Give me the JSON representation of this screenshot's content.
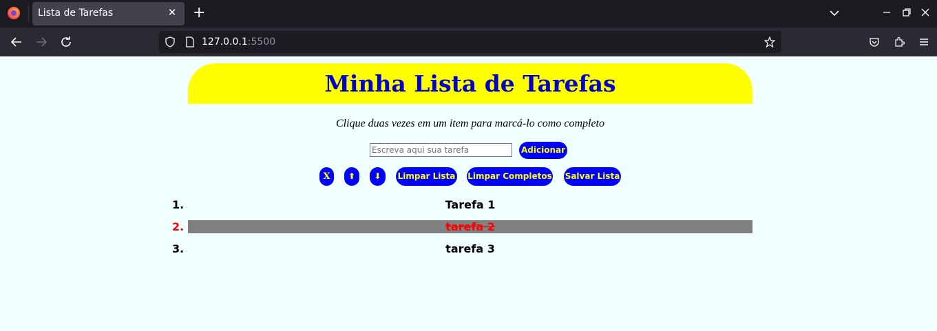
{
  "browser": {
    "tab_title": "Lista de Tarefas",
    "tab_close": "✕",
    "new_tab": "+",
    "url_host": "127.0.0.1",
    "url_port": ":5500"
  },
  "page": {
    "title": "Minha Lista de Tarefas",
    "subtitle": "Clique duas vezes em um item para marcá-lo como completo",
    "input_placeholder": "Escreva aqui sua tarefa",
    "add_button": "Adicionar",
    "buttons": {
      "remove": "X",
      "up": "⬆",
      "down": "⬇",
      "clear_list": "Limpar Lista",
      "clear_completed": "Limpar Completos",
      "save_list": "Salvar Lista"
    },
    "tasks": [
      {
        "num": "1.",
        "text": "Tarefa 1",
        "completed": false
      },
      {
        "num": "2.",
        "text": "tarefa 2",
        "completed": true
      },
      {
        "num": "3.",
        "text": "tarefa 3",
        "completed": false
      }
    ]
  },
  "colors": {
    "page_bg": "#f0ffff",
    "header_bg": "#ffff00",
    "title_color": "#0000cd",
    "button_bg": "#0000ff",
    "button_text": "#ffff00",
    "completed_bg": "#808080",
    "completed_text": "#ff0000"
  }
}
